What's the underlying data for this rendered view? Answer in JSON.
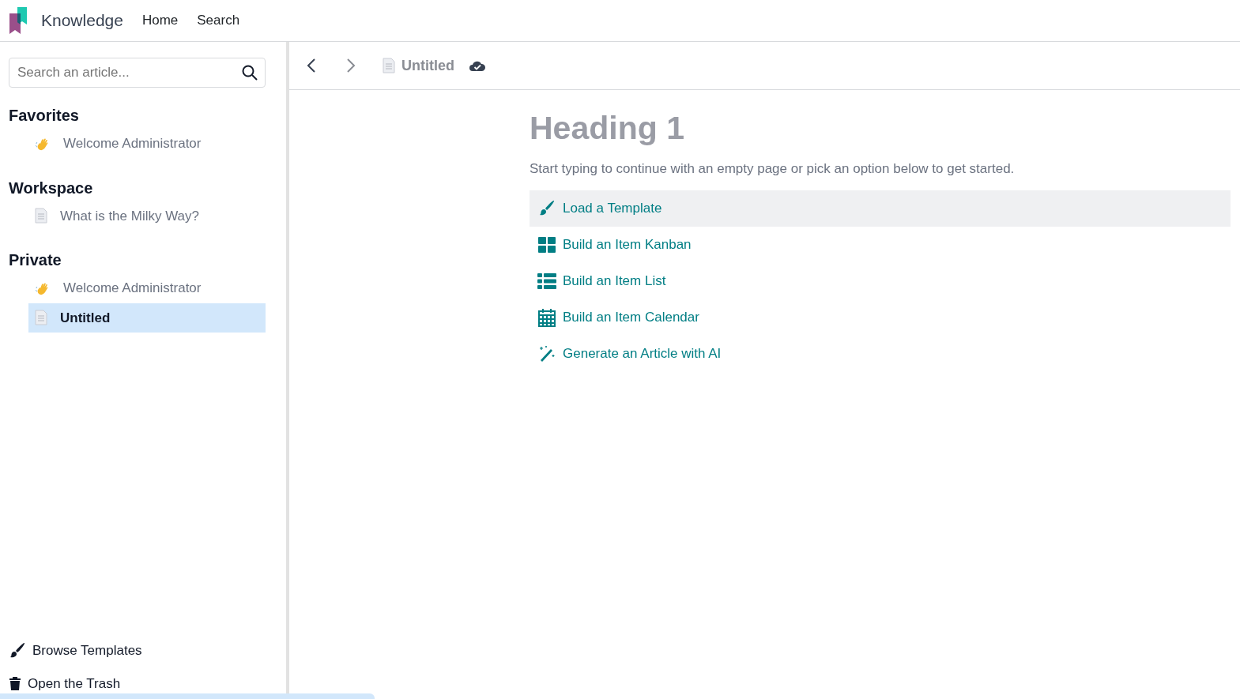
{
  "navbar": {
    "app_name": "Knowledge",
    "menu": [
      "Home",
      "Search"
    ]
  },
  "sidebar": {
    "search": {
      "placeholder": "Search an article..."
    },
    "sections": [
      {
        "title": "Favorites",
        "items": [
          {
            "label": "Welcome Administrator",
            "kind": "wave",
            "selected": false
          }
        ]
      },
      {
        "title": "Workspace",
        "items": [
          {
            "label": "What is the Milky Way?",
            "kind": "document",
            "selected": false
          }
        ]
      },
      {
        "title": "Private",
        "items": [
          {
            "label": "Welcome Administrator",
            "kind": "wave",
            "selected": false
          },
          {
            "label": "Untitled",
            "kind": "document",
            "selected": true
          }
        ]
      }
    ],
    "footer": [
      {
        "label": "Browse Templates",
        "kind": "brush"
      },
      {
        "label": "Open the Trash",
        "kind": "trash"
      }
    ]
  },
  "toolbar": {
    "breadcrumb": "Untitled",
    "saved": true
  },
  "article": {
    "heading": "Heading 1",
    "intro": "Start typing to continue with an empty page or pick an option below to get started.",
    "options": [
      {
        "label": "Load a Template",
        "kind": "brush",
        "hovered": true
      },
      {
        "label": "Build an Item Kanban",
        "kind": "kanban",
        "hovered": false
      },
      {
        "label": "Build an Item List",
        "kind": "list",
        "hovered": false
      },
      {
        "label": "Build an Item Calendar",
        "kind": "calendar",
        "hovered": false
      },
      {
        "label": "Generate an Article with AI",
        "kind": "wand",
        "hovered": false
      }
    ]
  }
}
